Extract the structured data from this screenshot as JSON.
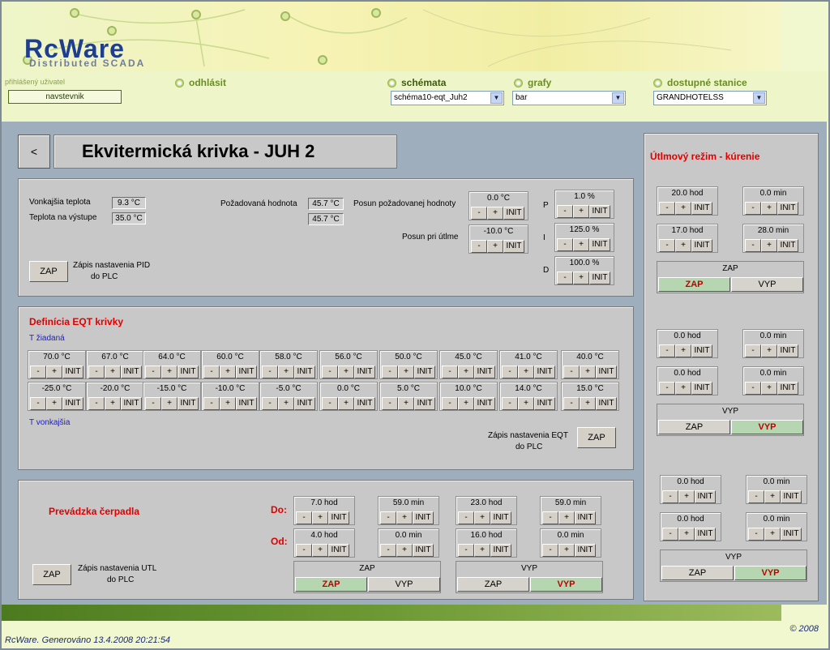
{
  "brand": {
    "logo": "RcWare",
    "subtitle": "Distributed SCADA"
  },
  "nav": {
    "user_label": "přihlášený uživatel",
    "user": "navstevnik",
    "logout": "odhlásit",
    "schemes_label": "schémata",
    "schemes_selected": "schéma10-eqt_Juh2",
    "graphs_label": "grafy",
    "graphs_selected": "bar",
    "stations_label": "dostupné stanice",
    "stations_selected": "GRANDHOTELSS"
  },
  "page": {
    "back": "<",
    "title": "Ekvitermická krivka - JUH 2"
  },
  "buttons": {
    "minus": "-",
    "plus": "+",
    "init": "INIT",
    "zap": "ZAP",
    "vyp": "VYP"
  },
  "pid": {
    "outside_temp_label": "Vonkajšia teplota",
    "outside_temp": "9.3 °C",
    "output_temp_label": "Teplota na výstupe",
    "output_temp": "35.0 °C",
    "required_label": "Požadovaná hodnota",
    "required": "45.7 °C",
    "required2": "45.7 °C",
    "shift_label": "Posun požadovanej hodnoty",
    "shift": "0.0 °C",
    "shift_utl_label": "Posun pri útlme",
    "shift_utl": "-10.0 °C",
    "p_label": "P",
    "p": "1.0 %",
    "i_label": "I",
    "i": "125.0 %",
    "d_label": "D",
    "d": "100.0 %",
    "write_label_1": "Zápis nastavenia PID",
    "write_label_2": "do PLC"
  },
  "eqt": {
    "title": "Definícia EQT krivky",
    "t_required_label": "T žiadaná",
    "t_outside_label": "T vonkajšia",
    "required": [
      "70.0 °C",
      "67.0 °C",
      "64.0 °C",
      "60.0 °C",
      "58.0 °C",
      "56.0 °C",
      "50.0 °C",
      "45.0 °C",
      "41.0 °C",
      "40.0 °C"
    ],
    "outside": [
      "-25.0 °C",
      "-20.0 °C",
      "-15.0 °C",
      "-10.0 °C",
      "-5.0 °C",
      "0.0 °C",
      "5.0 °C",
      "10.0 °C",
      "14.0 °C",
      "15.0 °C"
    ],
    "write_label_1": "Zápis nastavenia EQT",
    "write_label_2": "do PLC"
  },
  "pump": {
    "title": "Prevádzka čerpadla",
    "do_label": "Do:",
    "od_label": "Od:",
    "do_values": [
      "7.0 hod",
      "59.0 min",
      "23.0 hod",
      "59.0 min"
    ],
    "od_values": [
      "4.0 hod",
      "0.0 min",
      "16.0 hod",
      "0.0 min"
    ],
    "toggle1_title": "ZAP",
    "toggle2_title": "VYP",
    "write_label_1": "Zápis nastavenia UTL",
    "write_label_2": "do PLC"
  },
  "utl": {
    "title": "Útlmový režim - kúrenie",
    "g1": {
      "values": [
        "20.0 hod",
        "0.0 min",
        "17.0 hod",
        "28.0 min"
      ],
      "state": "ZAP"
    },
    "g2": {
      "values": [
        "0.0 hod",
        "0.0 min",
        "0.0 hod",
        "0.0 min"
      ],
      "state": "VYP"
    },
    "g3": {
      "values": [
        "0.0 hod",
        "0.0 min",
        "0.0 hod",
        "0.0 min"
      ],
      "state": "VYP"
    }
  },
  "footer": {
    "generated": "RcWare. Generováno 13.4.2008 20:21:54",
    "copyright": "© 2008"
  },
  "colors": {
    "accent_green": "#6a8d24",
    "panel_gray": "#c8c8c8",
    "bg_blue_gray": "#9eaebc",
    "active_red": "#e00000"
  }
}
